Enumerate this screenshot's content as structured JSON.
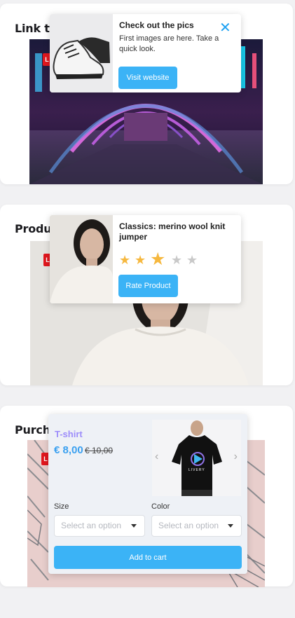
{
  "cards": [
    {
      "title": "Link to products",
      "badge": "L",
      "popup": {
        "heading": "Check out the pics",
        "text": "First images are here. Take a quick look.",
        "button": "Visit website",
        "close_icon": "close-icon"
      }
    },
    {
      "title": "Product rating",
      "badge": "L",
      "popup": {
        "heading": "Classics: merino wool knit jumper",
        "rating": 3,
        "rating_max": 5,
        "button": "Rate Product"
      }
    },
    {
      "title": "Purchase",
      "badge": "L",
      "popup": {
        "product_name": "T-shirt",
        "price": "€ 8,00",
        "old_price": "€ 10,00",
        "tshirt_brand": "LIVERY",
        "size_label": "Size",
        "size_placeholder": "Select an option",
        "color_label": "Color",
        "color_placeholder": "Select an option",
        "button": "Add to cart"
      }
    }
  ],
  "colors": {
    "accent": "#3bb3f6",
    "badge": "#e1171e",
    "star": "#f6b83f",
    "price": "#3aa0f0",
    "product_name": "#9d8dfa"
  }
}
